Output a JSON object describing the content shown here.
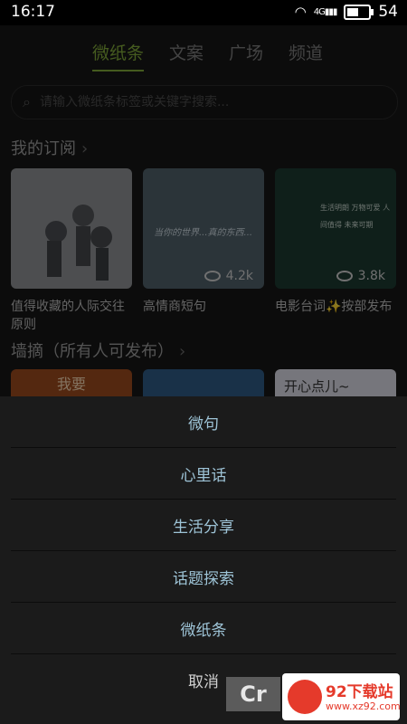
{
  "status": {
    "time": "16:17",
    "network": "4G",
    "battery": "54",
    "battery_level": 0.54
  },
  "tabs": [
    {
      "label": "微纸条",
      "active": true
    },
    {
      "label": "文案",
      "active": false
    },
    {
      "label": "广场",
      "active": false
    },
    {
      "label": "频道",
      "active": false
    }
  ],
  "search": {
    "placeholder": "请输入微纸条标签或关键字搜索..."
  },
  "sections": {
    "subs": "我的订阅",
    "wall": "墙摘（所有人可发布）"
  },
  "cards": [
    {
      "caption": "值得收藏的人际交往原则",
      "views": "",
      "image_text": ""
    },
    {
      "caption": "高情商短句",
      "views": "4.2k",
      "image_text": "当你的世界...真的东西..."
    },
    {
      "caption": "电影台词✨按部发布",
      "views": "3.8k",
      "image_text": "生活明朗 万物可爱 人间值得 未来可期"
    }
  ],
  "wall_peek": {
    "card3_title": "开心点儿~",
    "card1_text": "我要"
  },
  "sheet": {
    "options": [
      "微句",
      "心里话",
      "生活分享",
      "话题探索",
      "微纸条"
    ],
    "cancel": "取消"
  },
  "watermark": {
    "site": "92下载站",
    "url": "www.xz92.com",
    "letters": "Cr"
  }
}
